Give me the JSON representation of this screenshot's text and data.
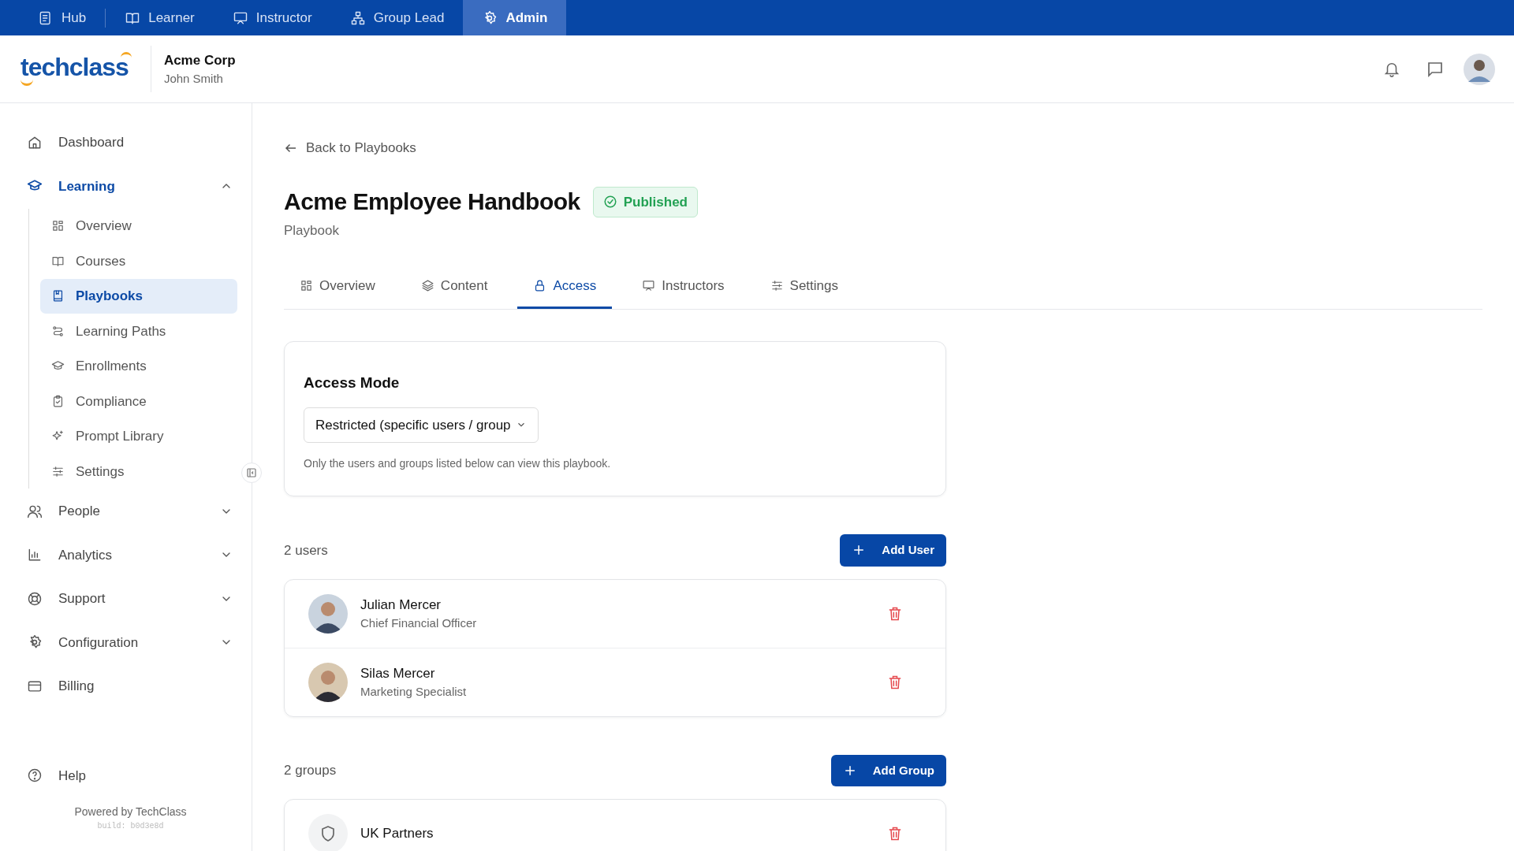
{
  "top_nav": [
    {
      "label": "Hub",
      "selected": false
    },
    {
      "label": "Learner",
      "selected": false
    },
    {
      "label": "Instructor",
      "selected": false
    },
    {
      "label": "Group Lead",
      "selected": false
    },
    {
      "label": "Admin",
      "selected": true
    }
  ],
  "header": {
    "logo": "techclass",
    "org": "Acme Corp",
    "user": "John Smith"
  },
  "sidebar": {
    "items": [
      {
        "label": "Dashboard",
        "selected": false
      },
      {
        "label": "Learning",
        "selected": true,
        "expanded": true,
        "children": [
          {
            "label": "Overview",
            "selected": false
          },
          {
            "label": "Courses",
            "selected": false
          },
          {
            "label": "Playbooks",
            "selected": true
          },
          {
            "label": "Learning Paths",
            "selected": false
          },
          {
            "label": "Enrollments",
            "selected": false
          },
          {
            "label": "Compliance",
            "selected": false
          },
          {
            "label": "Prompt Library",
            "selected": false
          },
          {
            "label": "Settings",
            "selected": false
          }
        ]
      },
      {
        "label": "People",
        "selected": false,
        "expanded": false
      },
      {
        "label": "Analytics",
        "selected": false,
        "expanded": false
      },
      {
        "label": "Support",
        "selected": false,
        "expanded": false
      },
      {
        "label": "Configuration",
        "selected": false,
        "expanded": false
      },
      {
        "label": "Billing",
        "selected": false
      }
    ],
    "help": "Help",
    "powered_by": "Powered by TechClass",
    "build": "build: b0d3e8d"
  },
  "back_link": "Back to Playbooks",
  "title": "Acme Employee Handbook",
  "status": "Published",
  "subtitle": "Playbook",
  "tabs": [
    {
      "label": "Overview",
      "selected": false
    },
    {
      "label": "Content",
      "selected": false
    },
    {
      "label": "Access",
      "selected": true
    },
    {
      "label": "Instructors",
      "selected": false
    },
    {
      "label": "Settings",
      "selected": false
    }
  ],
  "access": {
    "heading": "Access Mode",
    "mode": "Restricted (specific users / group",
    "hint": "Only the users and groups listed below can view this playbook."
  },
  "users_count": "2 users",
  "add_user": "Add User",
  "users": [
    {
      "name": "Julian Mercer",
      "role": "Chief Financial Officer"
    },
    {
      "name": "Silas Mercer",
      "role": "Marketing Specialist"
    }
  ],
  "groups_count": "2 groups",
  "add_group": "Add Group",
  "groups": [
    {
      "name": "UK Partners"
    }
  ]
}
